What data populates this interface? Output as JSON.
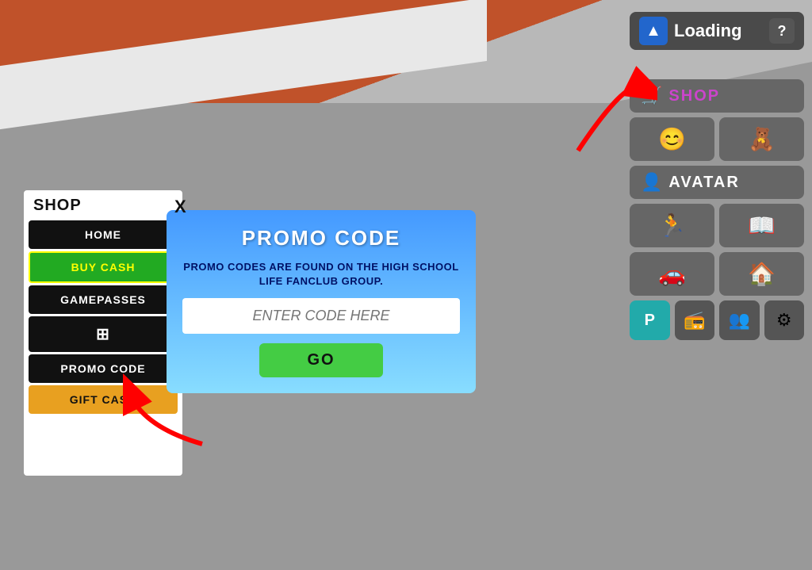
{
  "background": {
    "color": "#999999"
  },
  "top_bar": {
    "loading_label": "Loading",
    "question_label": "?",
    "icon_symbol": "▲"
  },
  "right_panel": {
    "shop_label": "SHOP",
    "avatar_label": "AVATAR",
    "cart_icon": "🛒",
    "emoji_icon": "😊",
    "bear_icon": "🧸",
    "avatar_icon": "👤",
    "run_icon": "🏃",
    "book_icon": "📖",
    "car_icon": "🚗",
    "house_icon": "🏠",
    "p_icon": "P",
    "radio_icon": "📻",
    "people_icon": "👥",
    "gear_icon": "⚙"
  },
  "shop_panel": {
    "title": "SHOP",
    "close_label": "X",
    "menu_items": [
      {
        "label": "HOME",
        "style": "black"
      },
      {
        "label": "BUY CASH",
        "style": "green"
      },
      {
        "label": "GAMEPASSES",
        "style": "dark"
      },
      {
        "label": "⊞",
        "style": "icon-item"
      },
      {
        "label": "PROMO CODE",
        "style": "promo"
      },
      {
        "label": "GIFT CASH",
        "style": "gift"
      }
    ]
  },
  "promo_dialog": {
    "title": "PROMO CODE",
    "description": "PROMO CODES ARE FOUND ON THE HIGH\nSCHOOL LIFE FANCLUB GROUP.",
    "input_placeholder": "ENTER CODE HERE",
    "go_label": "GO"
  }
}
